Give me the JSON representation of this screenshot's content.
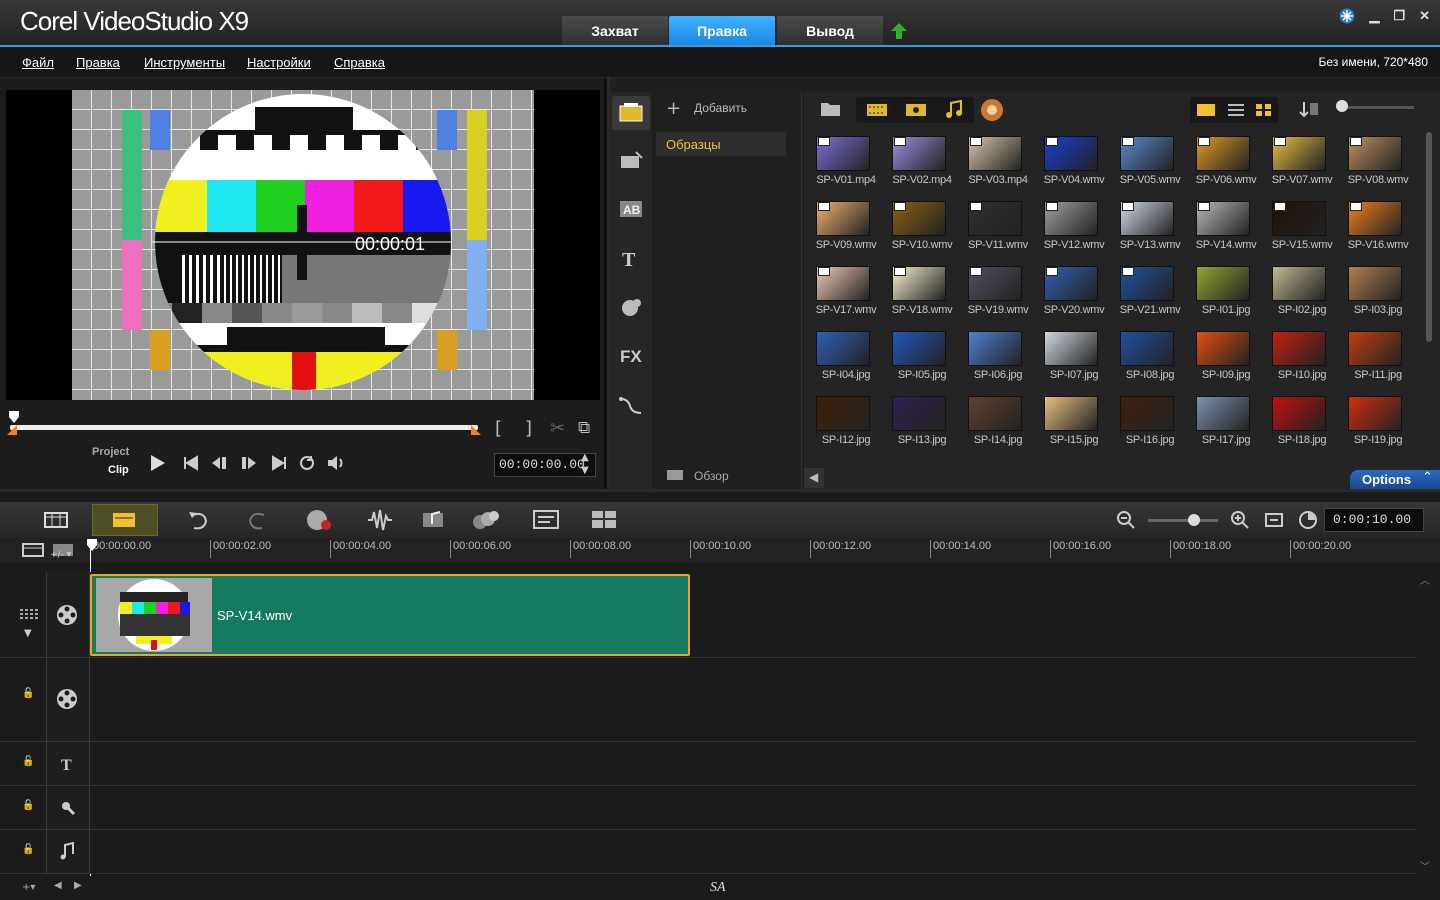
{
  "app": {
    "brand": "Corel VideoStudio X9",
    "project_info": "Без имени, 720*480"
  },
  "tabs": [
    {
      "label": "Захват"
    },
    {
      "label": "Правка"
    },
    {
      "label": "Вывод"
    }
  ],
  "menu": [
    "Файл",
    "Правка",
    "Инструменты",
    "Настройки",
    "Справка"
  ],
  "player": {
    "overlay_time": "00:00:01",
    "mode_project": "Project",
    "mode_clip": "Clip",
    "timecode": "00:00:00.00"
  },
  "library": {
    "add_label": "Добавить",
    "folder": "Образцы",
    "browse_label": "Обзор",
    "options_label": "Options",
    "items": [
      "SP-V01.mp4",
      "SP-V02.mp4",
      "SP-V03.mp4",
      "SP-V04.wmv",
      "SP-V05.wmv",
      "SP-V06.wmv",
      "SP-V07.wmv",
      "SP-V08.wmv",
      "SP-V09.wmv",
      "SP-V10.wmv",
      "SP-V11.wmv",
      "SP-V12.wmv",
      "SP-V13.wmv",
      "SP-V14.wmv",
      "SP-V15.wmv",
      "SP-V16.wmv",
      "SP-V17.wmv",
      "SP-V18.wmv",
      "SP-V19.wmv",
      "SP-V20.wmv",
      "SP-V21.wmv",
      "SP-I01.jpg",
      "SP-I02.jpg",
      "SP-I03.jpg",
      "SP-I04.jpg",
      "SP-I05.jpg",
      "SP-I06.jpg",
      "SP-I07.jpg",
      "SP-I08.jpg",
      "SP-I09.jpg",
      "SP-I10.jpg",
      "SP-I11.jpg",
      "SP-I12.jpg",
      "SP-I13.jpg",
      "SP-I14.jpg",
      "SP-I15.jpg",
      "SP-I16.jpg",
      "SP-I17.jpg",
      "SP-I18.jpg",
      "SP-I19.jpg"
    ],
    "thumb_colors": [
      "#7b6fd8",
      "#9b8fe0",
      "#d8c6a8",
      "#1a3fd0",
      "#5a8ad0",
      "#e09a20",
      "#e8c040",
      "#c09060",
      "#f0b070",
      "#8a6010",
      "#303030",
      "#a0a0a0",
      "#d0d8e8",
      "#b8b8b8",
      "#201008",
      "#f08020",
      "#f0c8b8",
      "#f8f0d0",
      "#505060",
      "#3060b0",
      "#2050a0",
      "#90a830",
      "#c0b890",
      "#b08050",
      "#3060b8",
      "#2058c0",
      "#5080d0",
      "#d0d8e0",
      "#2050a0",
      "#e05010",
      "#c02010",
      "#c04010",
      "#402008",
      "#302050",
      "#604030",
      "#e8c080",
      "#402010",
      "#8090b0",
      "#c01010",
      "#d03010"
    ]
  },
  "timeline": {
    "zoom_time": "0:00:10.00",
    "clip_name": "SP-V14.wmv",
    "ruler": [
      "00:00:00.00",
      "00:00:02.00",
      "00:00:04.00",
      "00:00:06.00",
      "00:00:08.00",
      "00:00:10.00",
      "00:00:12.00",
      "00:00:14.00",
      "00:00:16.00",
      "00:00:18.00",
      "00:00:20.00"
    ]
  },
  "footer": {
    "watermark": "SA"
  }
}
